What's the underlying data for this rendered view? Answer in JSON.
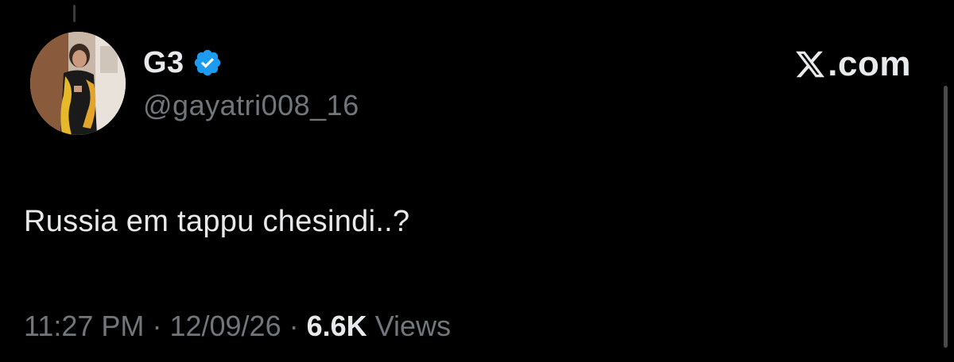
{
  "author": {
    "display_name": "G3",
    "handle": "@gayatri008_16",
    "verified": true,
    "verified_color": "#1d9bf0"
  },
  "brand": {
    "logo_icon": "x-logo-icon",
    "text": ".com"
  },
  "tweet": {
    "text": "Russia em tappu chesindi..?"
  },
  "meta": {
    "time": "11:27 PM",
    "separator": "·",
    "date": "12/09/26",
    "views_count": "6.6K",
    "views_label": "Views"
  }
}
